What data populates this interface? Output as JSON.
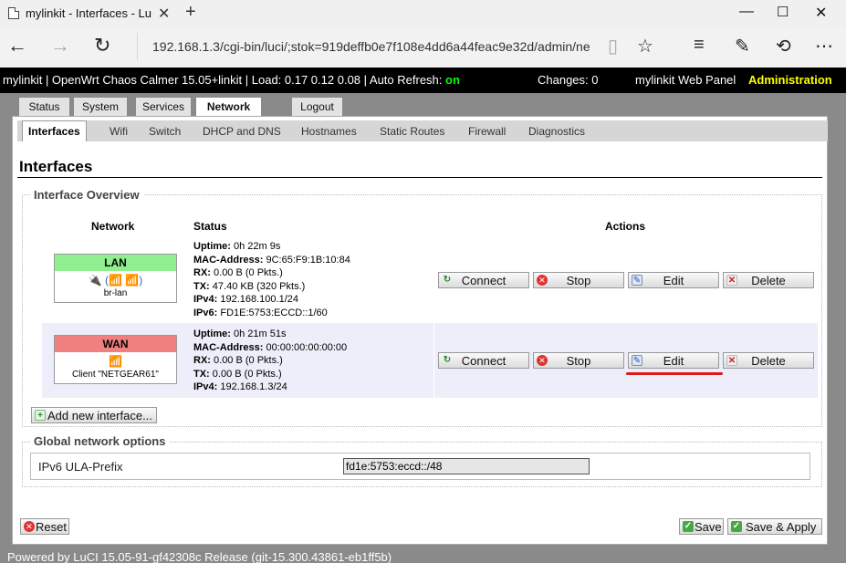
{
  "browser": {
    "tab_title": "mylinkit - Interfaces - Lu",
    "url": "192.168.1.3/cgi-bin/luci/;stok=919deffb0e7f108e4dd6a44feac9e32d/admin/ne",
    "icons": [
      "back-icon",
      "forward-icon",
      "refresh-icon",
      "reading-view-icon",
      "favorite-star-icon",
      "hub-icon",
      "web-note-icon",
      "share-icon",
      "more-icon"
    ]
  },
  "header": {
    "brand": "mylinkit | OpenWrt Chaos Calmer 15.05+linkit | Load: 0.17 0.12 0.08 | Auto Refresh:",
    "auto_refresh": "on",
    "changes": "Changes: 0",
    "panel": "mylinkit Web Panel",
    "admin": "Administration"
  },
  "menu": {
    "status": "Status",
    "system": "System",
    "services": "Services",
    "network": "Network",
    "logout": "Logout"
  },
  "subtabs": {
    "interfaces": "Interfaces",
    "wifi": "Wifi",
    "switch": "Switch",
    "dhcp": "DHCP and DNS",
    "hostnames": "Hostnames",
    "routes": "Static Routes",
    "firewall": "Firewall",
    "diagnostics": "Diagnostics"
  },
  "page_title": "Interfaces",
  "overview": {
    "legend": "Interface Overview",
    "col_network": "Network",
    "col_status": "Status",
    "col_actions": "Actions",
    "lan": {
      "name": "LAN",
      "color": "#90ee90",
      "icon_text": "🔌 (📶 📶)",
      "device": "br-lan",
      "uptime_label": "Uptime:",
      "uptime": "0h 22m 9s",
      "mac_label": "MAC-Address:",
      "mac": "9C:65:F9:1B:10:84",
      "rx_label": "RX:",
      "rx": "0.00 B (0 Pkts.)",
      "tx_label": "TX:",
      "tx": "47.40 KB (320 Pkts.)",
      "ipv4_label": "IPv4:",
      "ipv4": "192.168.100.1/24",
      "ipv6_label": "IPv6:",
      "ipv6": "FD1E:5753:ECCD::1/60"
    },
    "wan": {
      "name": "WAN",
      "color": "#f08080",
      "icon_text": "📶",
      "device": "Client \"NETGEAR61\"",
      "uptime_label": "Uptime:",
      "uptime": "0h 21m 51s",
      "mac_label": "MAC-Address:",
      "mac": "00:00:00:00:00:00",
      "rx_label": "RX:",
      "rx": "0.00 B (0 Pkts.)",
      "tx_label": "TX:",
      "tx": "0.00 B (0 Pkts.)",
      "ipv4_label": "IPv4:",
      "ipv4": "192.168.1.3/24"
    },
    "btn_connect": "Connect",
    "btn_stop": "Stop",
    "btn_edit": "Edit",
    "btn_delete": "Delete",
    "btn_add": "Add new interface..."
  },
  "global": {
    "legend": "Global network options",
    "ula_label": "IPv6 ULA-Prefix",
    "ula_value": "fd1e:5753:eccd::/48"
  },
  "actions": {
    "reset": "Reset",
    "save": "Save",
    "save_apply": "Save & Apply"
  },
  "footer": "Powered by LuCI 15.05-91-gf42308c Release (git-15.300.43861-eb1ff5b)"
}
